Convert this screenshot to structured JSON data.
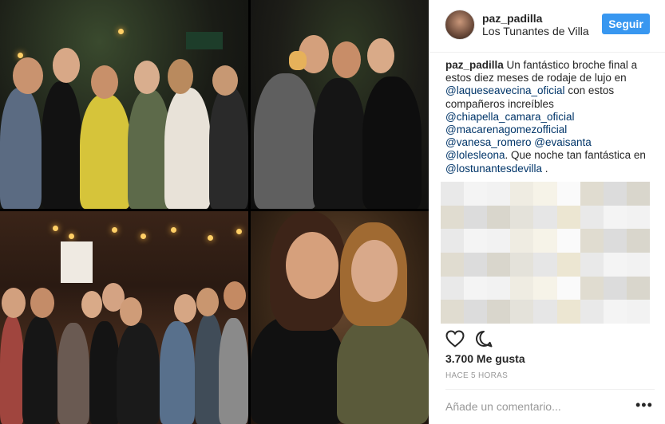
{
  "post": {
    "header": {
      "username": "paz_padilla",
      "location": "Los Tunantes de Villa",
      "follow_label": "Seguir"
    },
    "caption": {
      "username": "paz_padilla",
      "text_1": " Un fantástico broche final a estos diez meses de rodaje de lujo en ",
      "mention_1": "@laqueseavecina_oficial",
      "text_2": " con estos compañeros increíbles ",
      "mention_2": "@chiapella_camara_oficial",
      "mention_3": "@macarenagomezofficial",
      "mention_4": "@vanesa_romero",
      "mention_5": "@evaisanta",
      "mention_6": "@lolesleona",
      "text_3": ". Que noche tan fantástica en ",
      "mention_7": "@lostunantesdevilla",
      "text_4": " ."
    },
    "likes": "3.700 Me gusta",
    "timestamp": "HACE 5 HORAS",
    "comment_placeholder": "Añade un comentario...",
    "more_label": "•••",
    "icons": [
      "heart-icon",
      "comment-icon",
      "more-options-icon"
    ],
    "colors": {
      "follow_button": "#3897f0",
      "mention": "#003569",
      "timestamp": "#999999"
    }
  }
}
